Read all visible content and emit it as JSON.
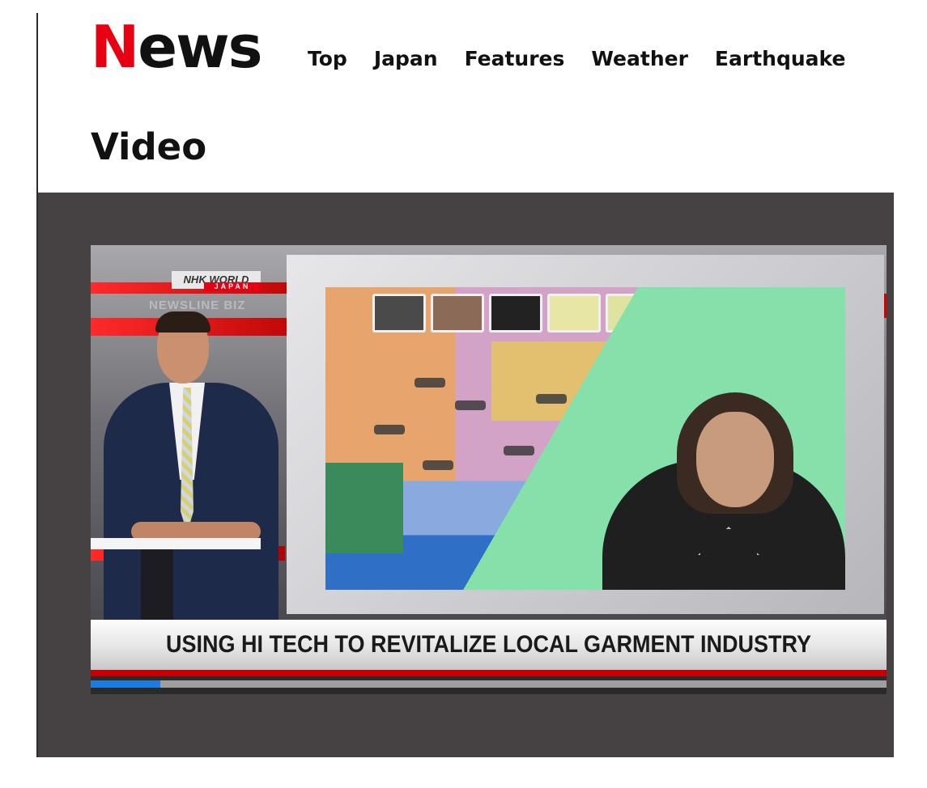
{
  "header": {
    "logo_first": "N",
    "logo_rest": "ews",
    "nav": [
      "Top",
      "Japan",
      "Features",
      "Weather",
      "Earthquake"
    ]
  },
  "page": {
    "title": "Video"
  },
  "video": {
    "channel_logo": "NHK WORLD",
    "channel_sub": "JAPAN",
    "program": "NEWSLINE BIZ",
    "headline": "USING HI TECH TO REVITALIZE LOCAL GARMENT INDUSTRY",
    "progress_fraction": 0.087
  },
  "colors": {
    "brand_red": "#e60012",
    "progress_blue": "#1c7be0",
    "player_bg": "#464142"
  }
}
